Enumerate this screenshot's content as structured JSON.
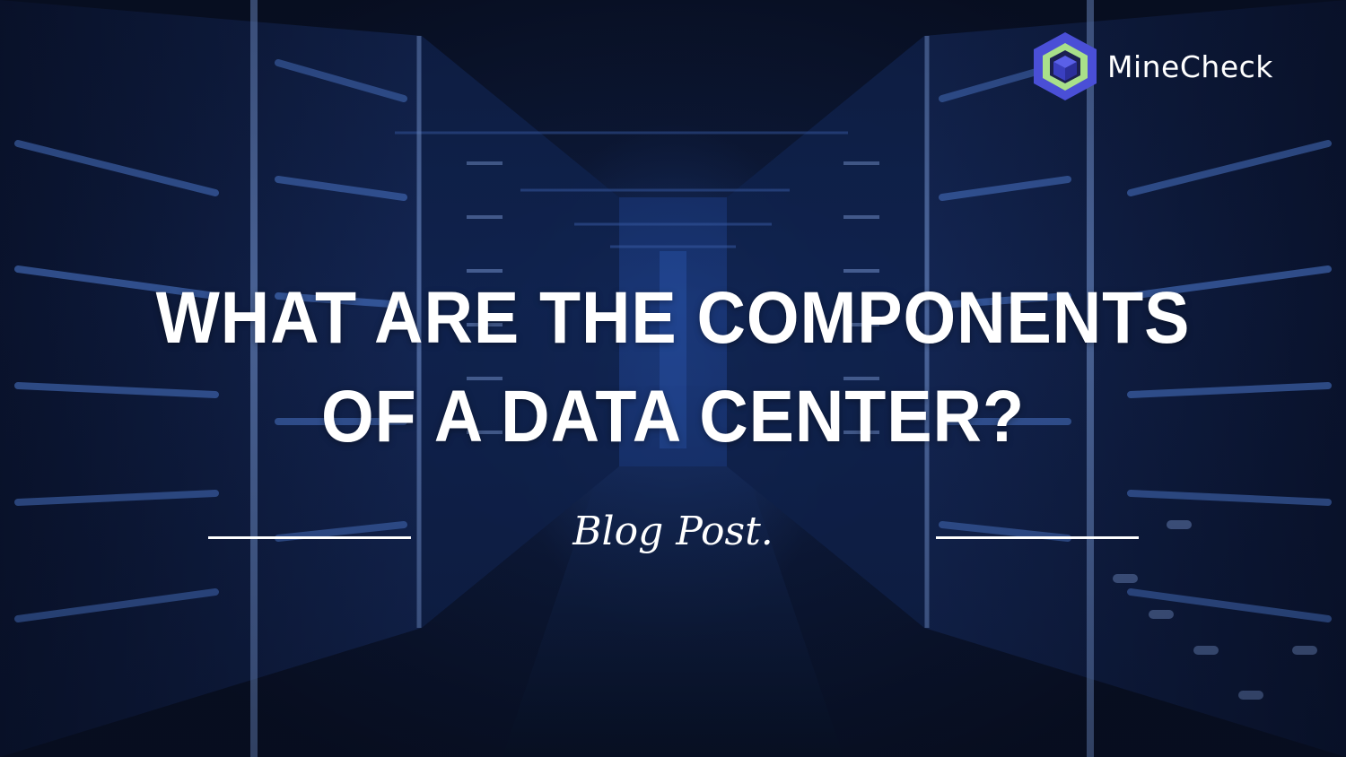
{
  "brand": {
    "logo_icon": "cube-icon",
    "name": "MineCheck",
    "colors": {
      "cube_outer": "#4a4fd6",
      "cube_inner": "#a9e08a",
      "cube_core": "#3a3fc0"
    }
  },
  "headline": {
    "line1": "WHAT ARE THE COMPONENTS",
    "line2": "OF A DATA CENTER?"
  },
  "subtitle": "Blog Post.",
  "theme": {
    "background": "#0d1a3a",
    "accent_light": "#5d86d8",
    "text": "#ffffff"
  }
}
